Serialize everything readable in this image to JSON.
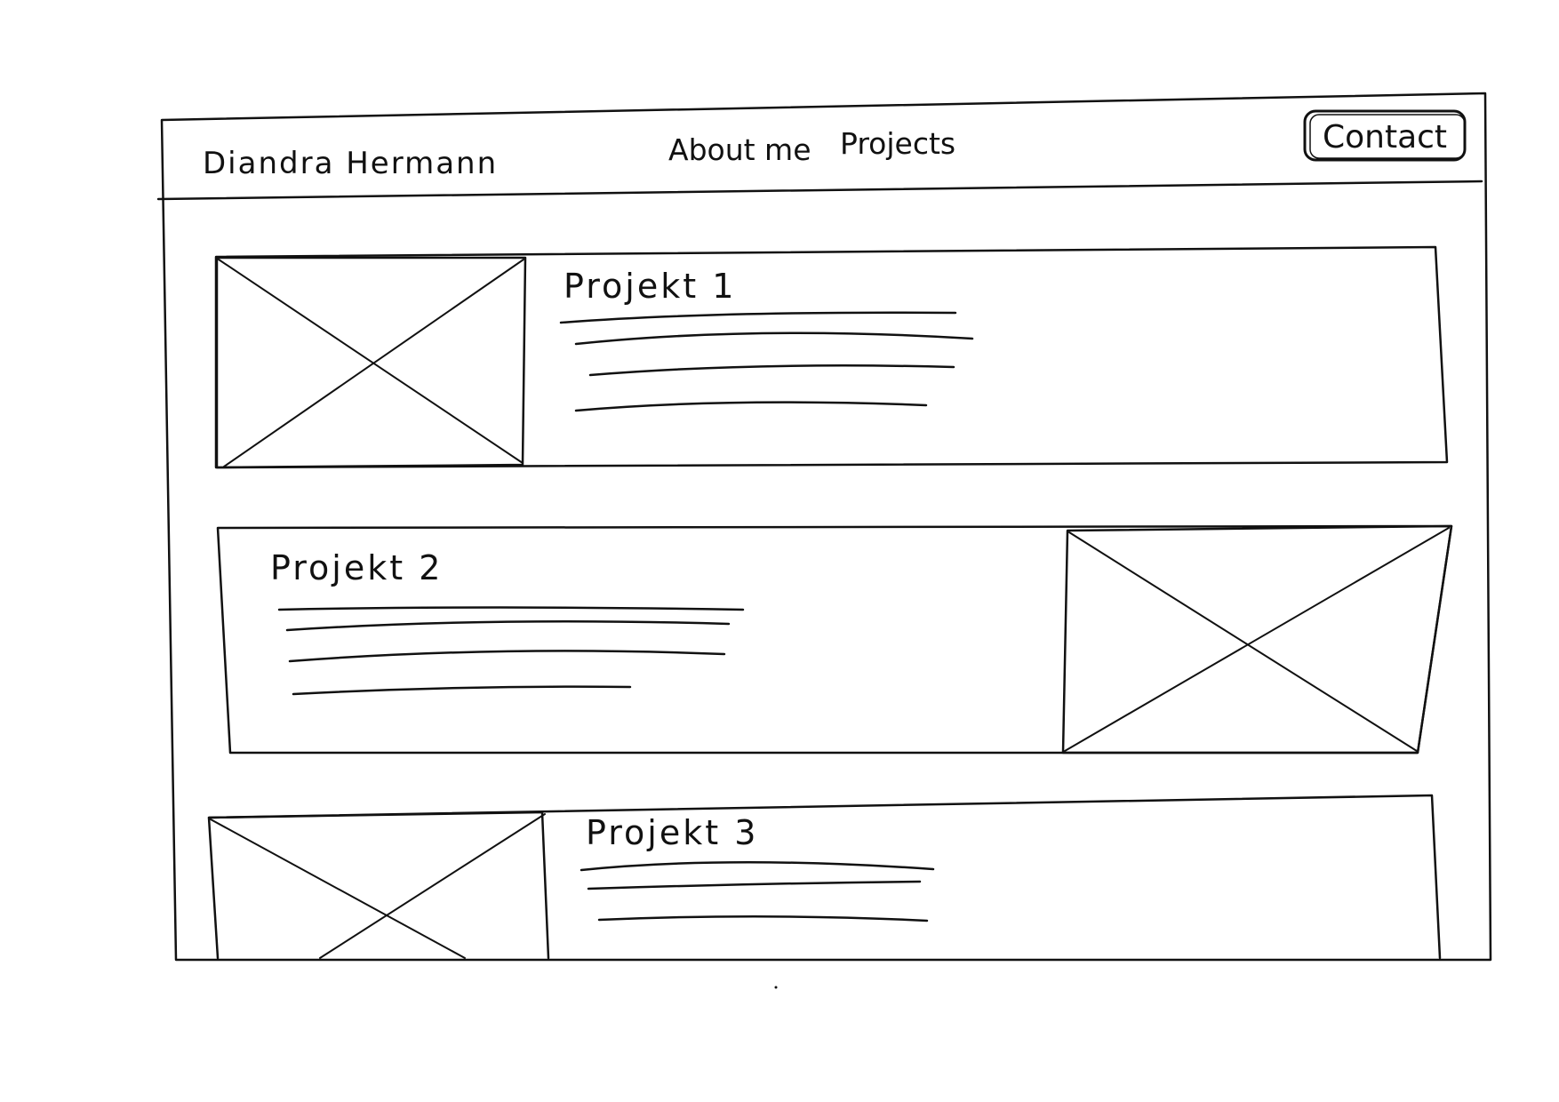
{
  "header": {
    "name": "Diandra Hermann",
    "nav": [
      {
        "label": "About me"
      },
      {
        "label": "Projects"
      }
    ],
    "contact_label": "Contact"
  },
  "projects": [
    {
      "title": "Projekt 1",
      "image_icon": "image-placeholder-icon"
    },
    {
      "title": "Projekt 2",
      "image_icon": "image-placeholder-icon"
    },
    {
      "title": "Projekt 3",
      "image_icon": "image-placeholder-icon"
    }
  ],
  "colors": {
    "ink": "#111111",
    "paper": "#ffffff"
  }
}
